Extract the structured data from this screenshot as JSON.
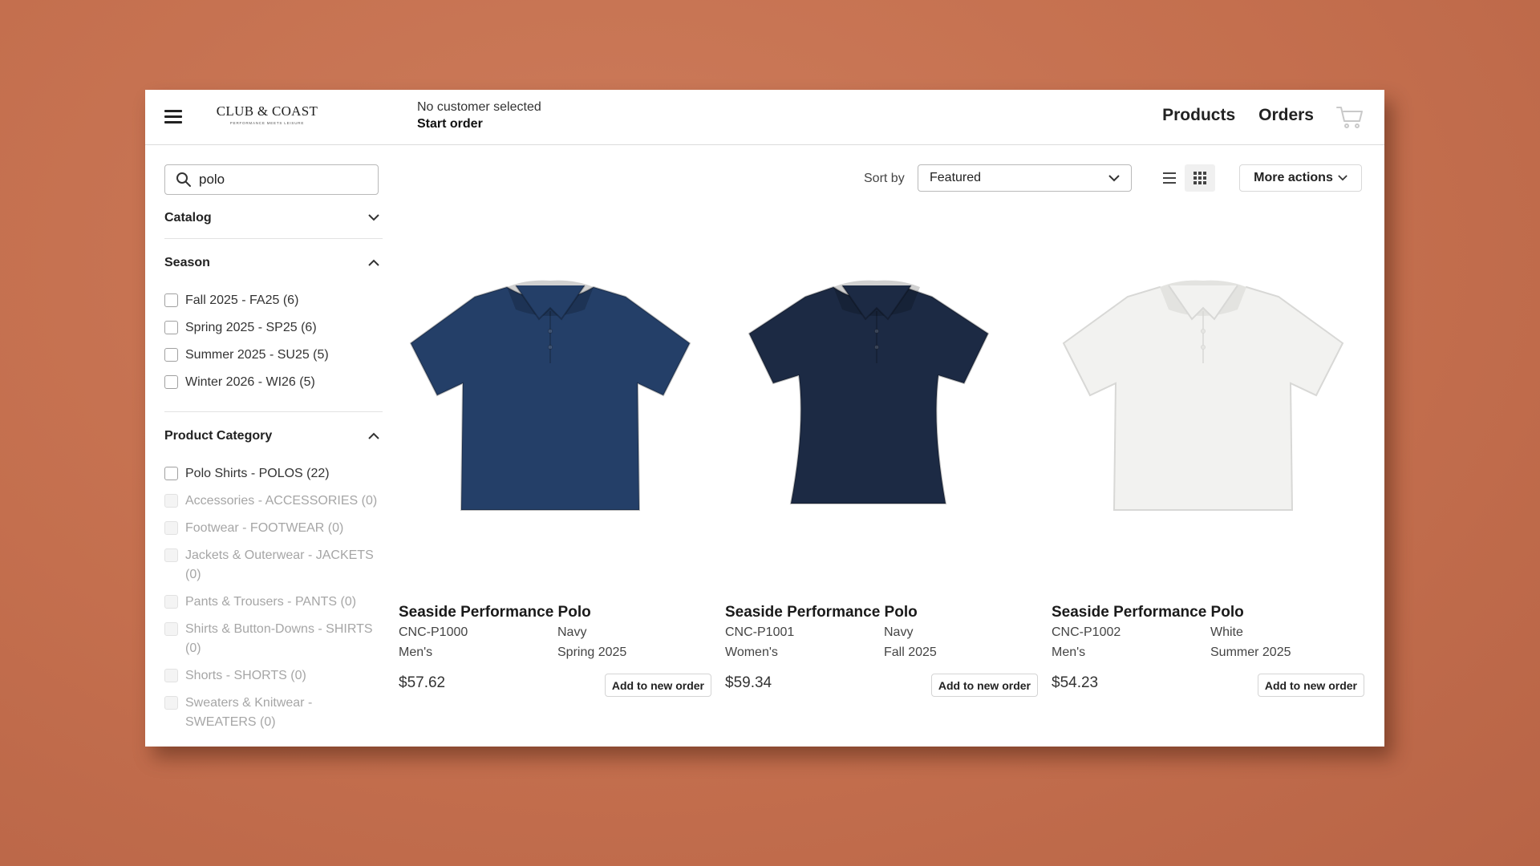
{
  "brand": {
    "name": "CLUB & COAST",
    "tagline": "PERFORMANCE MEETS LEISURE"
  },
  "header": {
    "customer_status": "No customer selected",
    "start_order": "Start order",
    "nav": [
      "Products",
      "Orders"
    ]
  },
  "search": {
    "value": "polo",
    "placeholder": ""
  },
  "facets": {
    "catalog": {
      "label": "Catalog",
      "expanded": false
    },
    "season": {
      "label": "Season",
      "expanded": true,
      "options": [
        {
          "label": "Fall 2025 - FA25 (6)",
          "enabled": true
        },
        {
          "label": "Spring 2025 - SP25 (6)",
          "enabled": true
        },
        {
          "label": "Summer 2025 - SU25 (5)",
          "enabled": true
        },
        {
          "label": "Winter 2026 - WI26 (5)",
          "enabled": true
        }
      ]
    },
    "category": {
      "label": "Product Category",
      "expanded": true,
      "options": [
        {
          "label": "Polo Shirts - POLOS (22)",
          "enabled": true
        },
        {
          "label": "Accessories - ACCESSORIES (0)",
          "enabled": false
        },
        {
          "label": "Footwear - FOOTWEAR (0)",
          "enabled": false
        },
        {
          "label": "Jackets & Outerwear - JACKETS (0)",
          "enabled": false
        },
        {
          "label": "Pants & Trousers - PANTS (0)",
          "enabled": false
        },
        {
          "label": "Shirts & Button-Downs - SHIRTS (0)",
          "enabled": false
        },
        {
          "label": "Shorts - SHORTS (0)",
          "enabled": false
        },
        {
          "label": "Sweaters & Knitwear - SWEATERS (0)",
          "enabled": false
        }
      ]
    }
  },
  "toolbar": {
    "sort_label": "Sort by",
    "sort_value": "Featured",
    "more_actions": "More actions"
  },
  "products": [
    {
      "name": "Seaside Performance Polo",
      "sku": "CNC-P1000",
      "color": "Navy",
      "gender": "Men's",
      "season": "Spring 2025",
      "price": "$57.62",
      "add_label": "Add to new order",
      "shirt_color": "#243f68",
      "style": "mens"
    },
    {
      "name": "Seaside Performance Polo",
      "sku": "CNC-P1001",
      "color": "Navy",
      "gender": "Women's",
      "season": "Fall 2025",
      "price": "$59.34",
      "add_label": "Add to new order",
      "shirt_color": "#1c2a44",
      "style": "womens"
    },
    {
      "name": "Seaside Performance Polo",
      "sku": "CNC-P1002",
      "color": "White",
      "gender": "Men's",
      "season": "Summer 2025",
      "price": "$54.23",
      "add_label": "Add to new order",
      "shirt_color": "#f2f2f0",
      "style": "mens"
    }
  ]
}
